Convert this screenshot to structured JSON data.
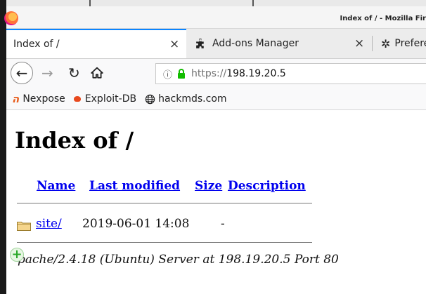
{
  "window": {
    "title": "Index of / - Mozilla Fir"
  },
  "tabs": [
    {
      "label": "Index of /",
      "close": "×"
    },
    {
      "label": "Add-ons Manager",
      "close": "×"
    },
    {
      "label": "Prefere"
    }
  ],
  "nav": {
    "back_icon": "back-arrow-icon",
    "forward_icon": "forward-arrow-icon",
    "reload_icon": "reload-icon",
    "home_icon": "home-icon",
    "url_prefix": "https://",
    "url_host": "198.19.20.5"
  },
  "bookmarks": [
    {
      "label": "Nexpose",
      "icon": "nexpose-icon"
    },
    {
      "label": "Exploit-DB",
      "icon": "exploit-db-icon"
    },
    {
      "label": "hackmds.com",
      "icon": "globe-icon"
    }
  ],
  "page": {
    "heading": "Index of /",
    "columns": {
      "name": "Name",
      "modified": "Last modified",
      "size": "Size",
      "description": "Description"
    },
    "rows": [
      {
        "name": "site/",
        "modified": "2019-06-01 14:08",
        "size": "-"
      }
    ],
    "address": "pache/2.4.18 (Ubuntu) Server at 198.19.20.5 Port 80"
  },
  "colors": {
    "link": "#0000ee",
    "accent": "#0a84ff",
    "lock": "#12bc00"
  }
}
